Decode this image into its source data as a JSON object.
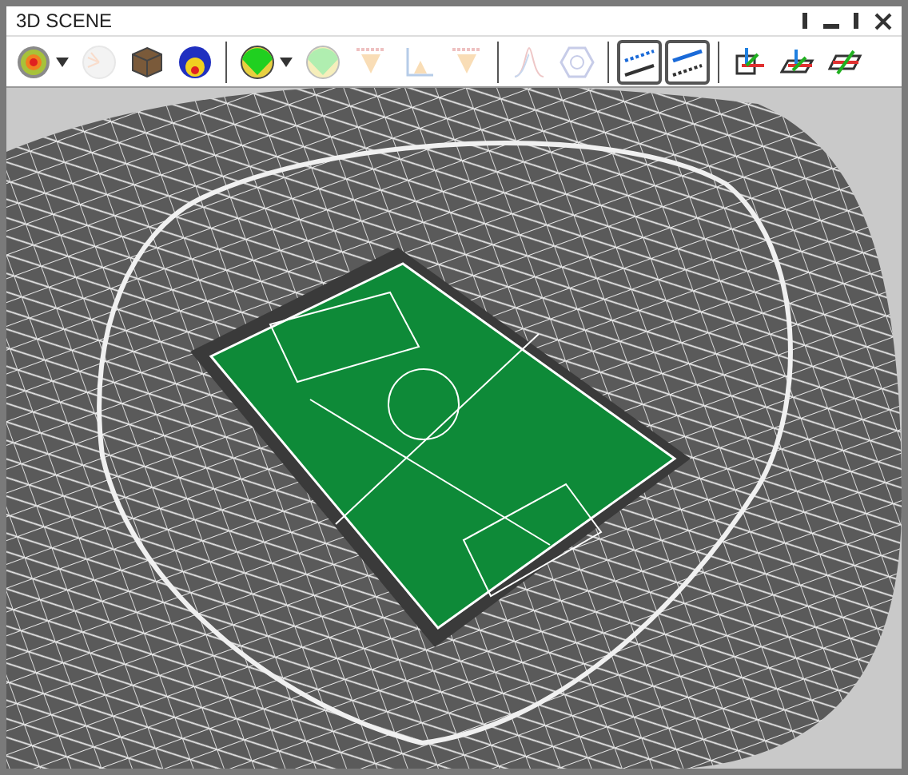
{
  "window": {
    "title": "3D SCENE"
  },
  "toolbar": {
    "groups": [
      [
        {
          "kind": "dropdown",
          "disabled": false
        },
        {
          "kind": "button",
          "disabled": true
        },
        {
          "kind": "button",
          "disabled": false
        },
        {
          "kind": "button",
          "disabled": false
        }
      ],
      [
        {
          "kind": "dropdown",
          "disabled": false
        },
        {
          "kind": "button",
          "disabled": true
        },
        {
          "kind": "button",
          "disabled": true
        },
        {
          "kind": "button",
          "disabled": true
        },
        {
          "kind": "button",
          "disabled": true
        }
      ],
      [
        {
          "kind": "button",
          "disabled": true
        },
        {
          "kind": "button",
          "disabled": true
        }
      ],
      [
        {
          "kind": "toggle",
          "selected": true
        },
        {
          "kind": "toggle",
          "selected": true
        }
      ],
      [
        {
          "kind": "button",
          "disabled": false
        },
        {
          "kind": "button",
          "disabled": false
        },
        {
          "kind": "button",
          "disabled": false
        }
      ]
    ]
  }
}
